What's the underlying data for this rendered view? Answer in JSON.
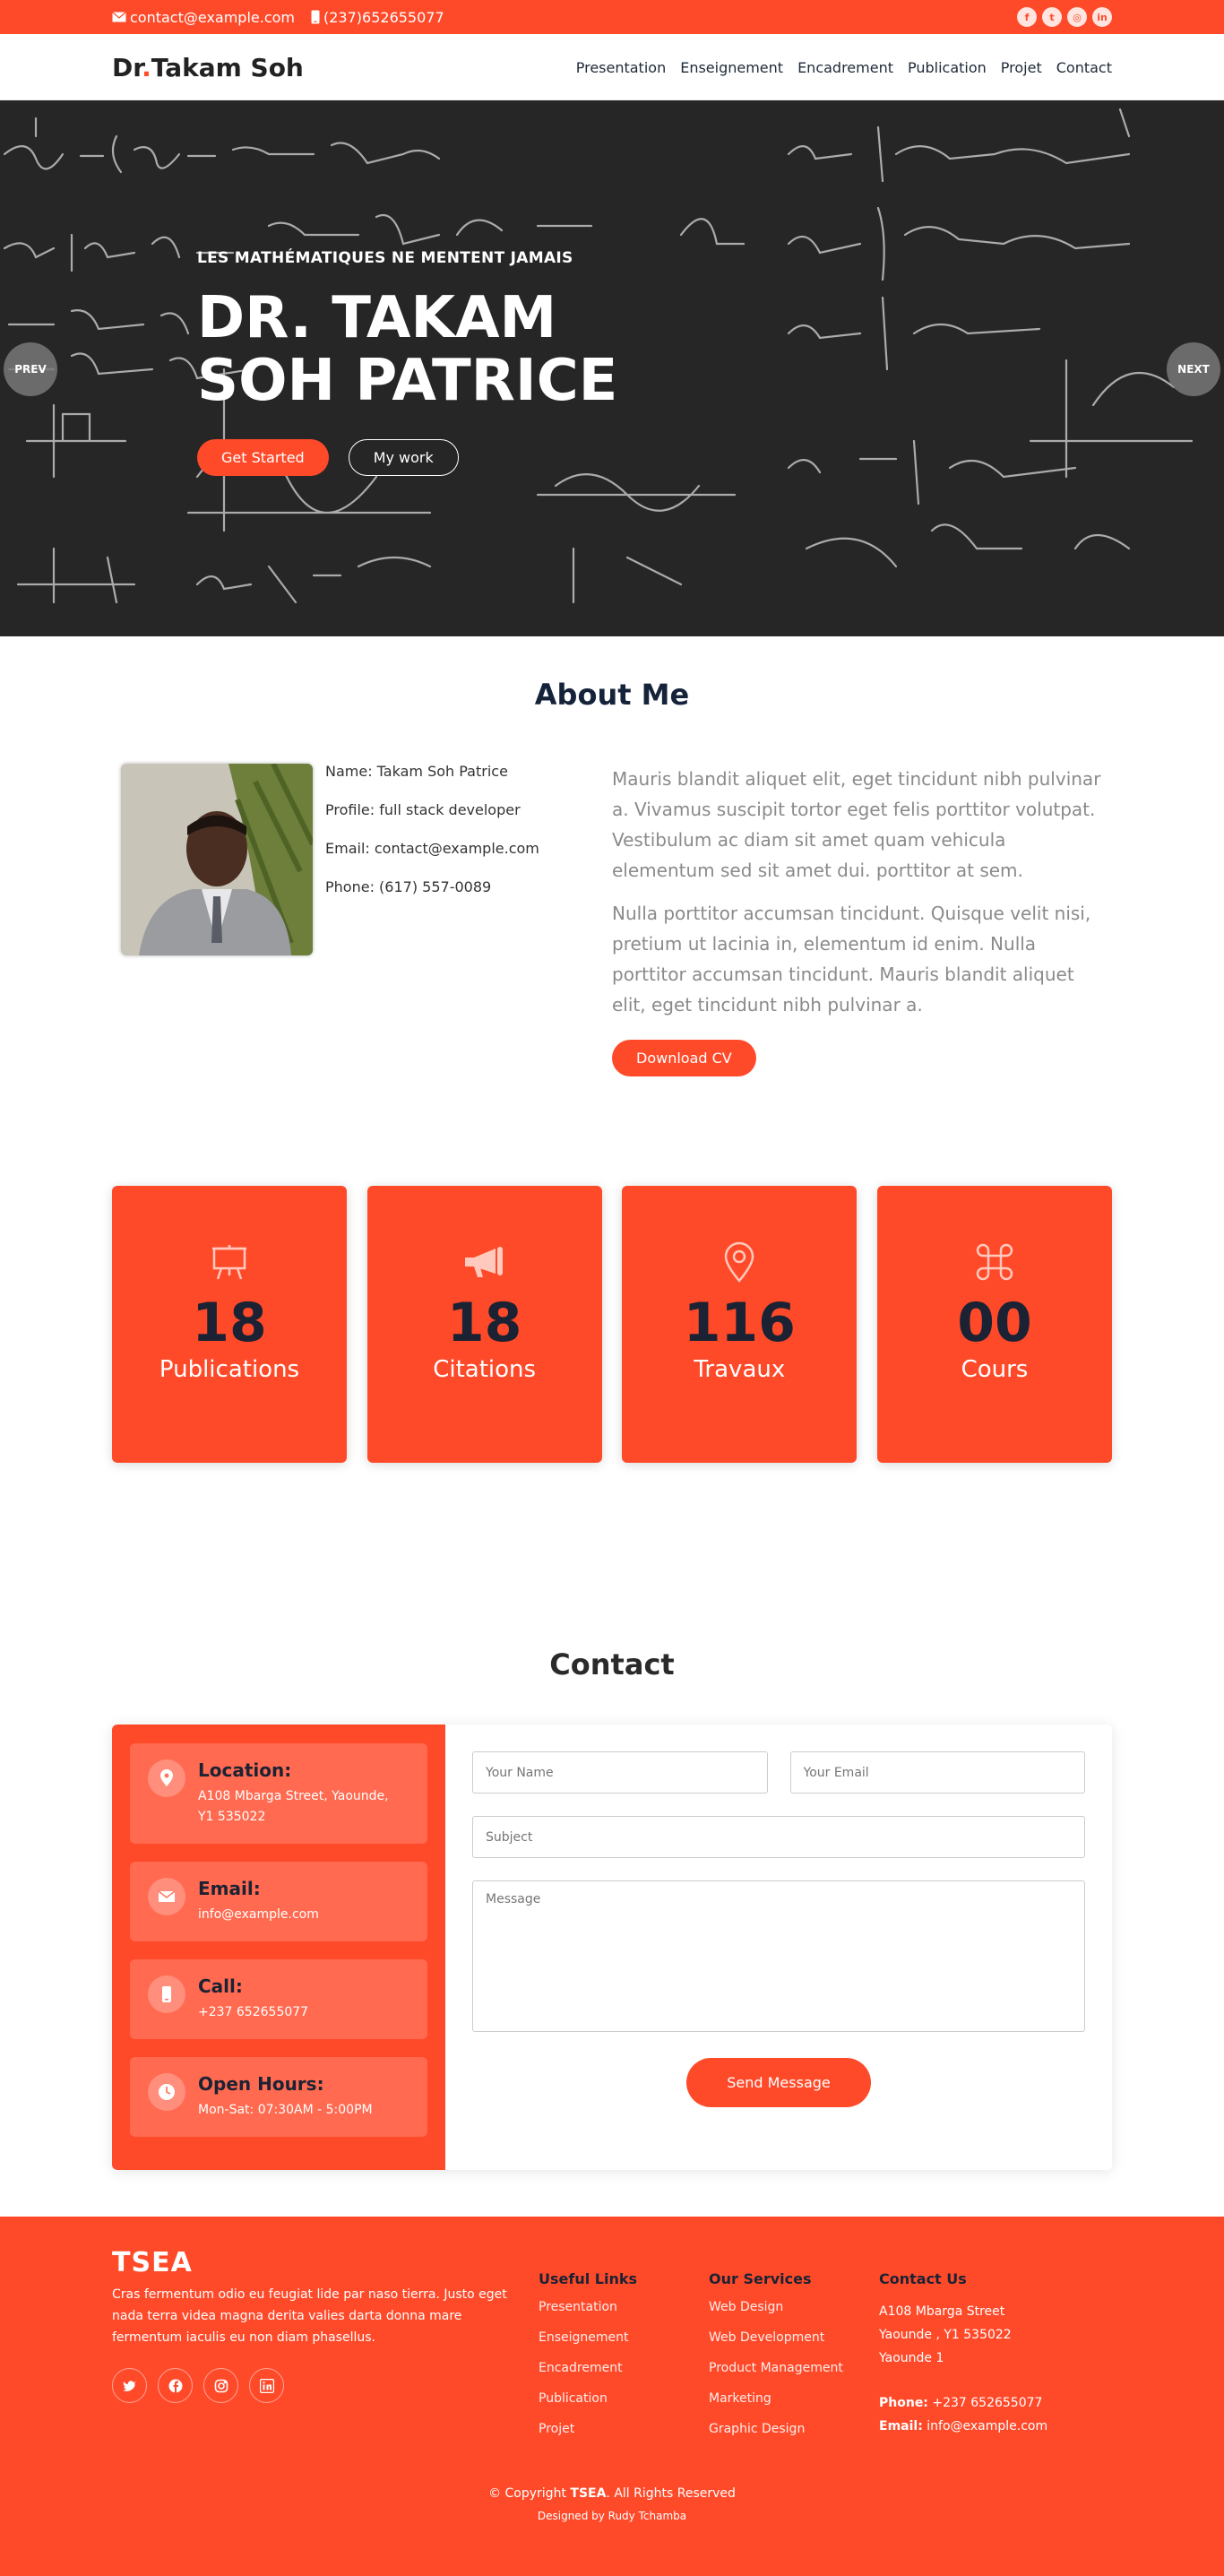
{
  "topbar": {
    "email": "contact@example.com",
    "phone": "(237)652655077"
  },
  "header": {
    "logo_first": "Dr",
    "logo_dot": ".",
    "logo_rest": "Takam Soh",
    "nav": [
      "Presentation",
      "Enseignement",
      "Encadrement",
      "Publication",
      "Projet",
      "Contact"
    ]
  },
  "hero": {
    "kicker": "LES MATHÉMATIQUES NE MENTENT JAMAIS",
    "title_line1": "DR. TAKAM",
    "title_line2": "SOH PATRICE",
    "btn_primary": "Get Started",
    "btn_secondary": "My work",
    "prev": "PREV",
    "next": "NEXT"
  },
  "about": {
    "title": "About Me",
    "name": "Name: Takam Soh Patrice",
    "profile": "Profile: full stack developer",
    "email": "Email: contact@example.com",
    "phone": "Phone: (617) 557-0089",
    "para1": "Mauris blandit aliquet elit, eget tincidunt nibh pulvinar a. Vivamus suscipit tortor eget felis porttitor volutpat. Vestibulum ac diam sit amet quam vehicula elementum sed sit amet dui. porttitor at sem.",
    "para2": "Nulla porttitor accumsan tincidunt. Quisque velit nisi, pretium ut lacinia in, elementum id enim. Nulla porttitor accumsan tincidunt. Mauris blandit aliquet elit, eget tincidunt nibh pulvinar a.",
    "cv_button": "Download CV"
  },
  "stats": [
    {
      "icon": "easel-icon",
      "value": "18",
      "label": "Publications"
    },
    {
      "icon": "megaphone-icon",
      "value": "18",
      "label": "Citations"
    },
    {
      "icon": "map-pin-icon",
      "value": "116",
      "label": "Travaux"
    },
    {
      "icon": "command-icon",
      "value": "00",
      "label": "Cours"
    }
  ],
  "contact": {
    "title": "Contact",
    "location_title": "Location:",
    "location_line1": "A108 Mbarga Street, Yaounde,",
    "location_line2": "Y1 535022",
    "email_title": "Email:",
    "email_value": "info@example.com",
    "call_title": "Call:",
    "call_value": "+237 652655077",
    "hours_title": "Open Hours:",
    "hours_value": "Mon-Sat: 07:30AM - 5:00PM",
    "form": {
      "name_placeholder": "Your Name",
      "email_placeholder": "Your Email",
      "subject_placeholder": "Subject",
      "message_placeholder": "Message",
      "send_label": "Send Message"
    }
  },
  "footer": {
    "brand": "TSEA",
    "about": "Cras fermentum odio eu feugiat lide par naso tierra. Justo eget nada terra videa magna derita valies darta donna mare fermentum iaculis eu non diam phasellus.",
    "useful_title": "Useful Links",
    "useful_links": [
      "Presentation",
      "Enseignement",
      "Encadrement",
      "Publication",
      "Projet"
    ],
    "services_title": "Our Services",
    "services": [
      "Web Design",
      "Web Development",
      "Product Management",
      "Marketing",
      "Graphic Design"
    ],
    "contact_title": "Contact Us",
    "address1": "A108 Mbarga Street",
    "address2": "Yaounde , Y1 535022",
    "address3": "Yaounde 1",
    "phone_label": "Phone:",
    "phone_value": "+237 652655077",
    "email_label": "Email:",
    "email_value": "info@example.com",
    "copyright_prefix": "© Copyright",
    "copyright_brand": "TSEA",
    "copyright_suffix": ". All Rights Reserved",
    "credits": "Designed by Rudy Tchamba"
  },
  "colors": {
    "accent": "#ff4a2a",
    "dark": "#1b2233"
  }
}
